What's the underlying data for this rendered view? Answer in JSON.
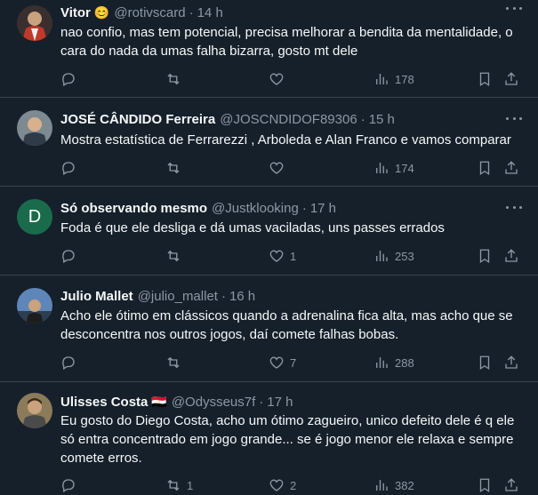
{
  "tweets": [
    {
      "name": "Vitor",
      "emoji": "😊",
      "handle": "@rotivscard",
      "time": "14 h",
      "text": "nao confio, mas tem potencial, precisa melhorar a bendita da mentalidade, o cara do nada da umas falha bizarra, gosto mt dele",
      "replies": "",
      "retweets": "",
      "likes": "",
      "views": "178",
      "avatar_color": "#b33a3a"
    },
    {
      "name": "JOSÉ CÂNDIDO Ferreira",
      "emoji": "",
      "handle": "@JOSCNDIDOF89306",
      "time": "15 h",
      "text": "Mostra estatística de Ferrarezzi , Arboleda e Alan Franco e vamos comparar",
      "replies": "",
      "retweets": "",
      "likes": "",
      "views": "174",
      "avatar_color": "#6b7680"
    },
    {
      "name": "Só observando mesmo",
      "emoji": "",
      "handle": "@Justklooking",
      "time": "17 h",
      "text": "Foda é que ele desliga e dá umas vaciladas, uns passes errados",
      "replies": "",
      "retweets": "",
      "likes": "1",
      "views": "253",
      "avatar_letter": "D",
      "avatar_color": "#1a6b4c"
    },
    {
      "name": "Julio Mallet",
      "emoji": "",
      "handle": "@julio_mallet",
      "time": "16 h",
      "text": "Acho ele ótimo em clássicos quando a adrenalina fica alta, mas acho que se desconcentra nos outros jogos, daí comete falhas bobas.",
      "replies": "",
      "retweets": "",
      "likes": "7",
      "views": "288",
      "avatar_color": "#4a6fa5"
    },
    {
      "name": "Ulisses Costa",
      "emoji": "🇪🇬",
      "handle": "@Odysseus7f",
      "time": "17 h",
      "text": "Eu gosto do Diego Costa, acho um ótimo zagueiro, unico defeito dele é q ele só entra concentrado em jogo grande... se é jogo menor ele relaxa e sempre comete erros.",
      "replies": "",
      "retweets": "1",
      "likes": "2",
      "views": "382",
      "avatar_color": "#7a6a4a"
    }
  ],
  "colors": {
    "background": "#15202b",
    "text": "#f7f9f9",
    "muted": "#8b98a5",
    "divider": "#38444d"
  },
  "icons": [
    "reply-icon",
    "retweet-icon",
    "like-icon",
    "views-icon",
    "bookmark-icon",
    "share-icon",
    "more-icon"
  ]
}
